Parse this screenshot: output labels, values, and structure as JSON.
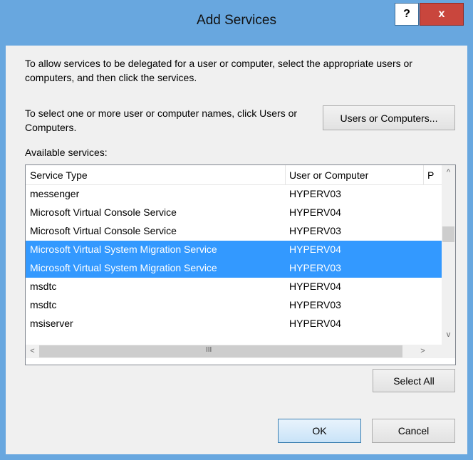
{
  "window": {
    "title": "Add Services",
    "help_label": "?",
    "close_label": "x"
  },
  "intro_text": "To allow services to be delegated for a user or computer, select the appropriate users or computers, and then click the services.",
  "select_text": "To select one or more user or computer names, click Users or Computers.",
  "users_button_label": "Users or Computers...",
  "available_label": "Available services:",
  "table": {
    "columns": [
      "Service Type",
      "User or Computer",
      "P"
    ],
    "rows": [
      {
        "service": "messenger",
        "computer": "HYPERV03",
        "selected": false
      },
      {
        "service": "Microsoft Virtual Console Service",
        "computer": "HYPERV04",
        "selected": false
      },
      {
        "service": "Microsoft Virtual Console Service",
        "computer": "HYPERV03",
        "selected": false
      },
      {
        "service": "Microsoft Virtual System Migration Service",
        "computer": "HYPERV04",
        "selected": true
      },
      {
        "service": "Microsoft Virtual System Migration Service",
        "computer": "HYPERV03",
        "selected": true
      },
      {
        "service": "msdtc",
        "computer": "HYPERV04",
        "selected": false
      },
      {
        "service": "msdtc",
        "computer": "HYPERV03",
        "selected": false
      },
      {
        "service": "msiserver",
        "computer": "HYPERV04",
        "selected": false
      }
    ]
  },
  "scroll_glyphs": {
    "up": "^",
    "down": "v",
    "left": "<",
    "right": ">",
    "grip": "III"
  },
  "select_all_label": "Select All",
  "ok_label": "OK",
  "cancel_label": "Cancel",
  "colors": {
    "title_bar": "#68a7df",
    "close_button": "#c9463d",
    "selection": "#3399ff"
  }
}
